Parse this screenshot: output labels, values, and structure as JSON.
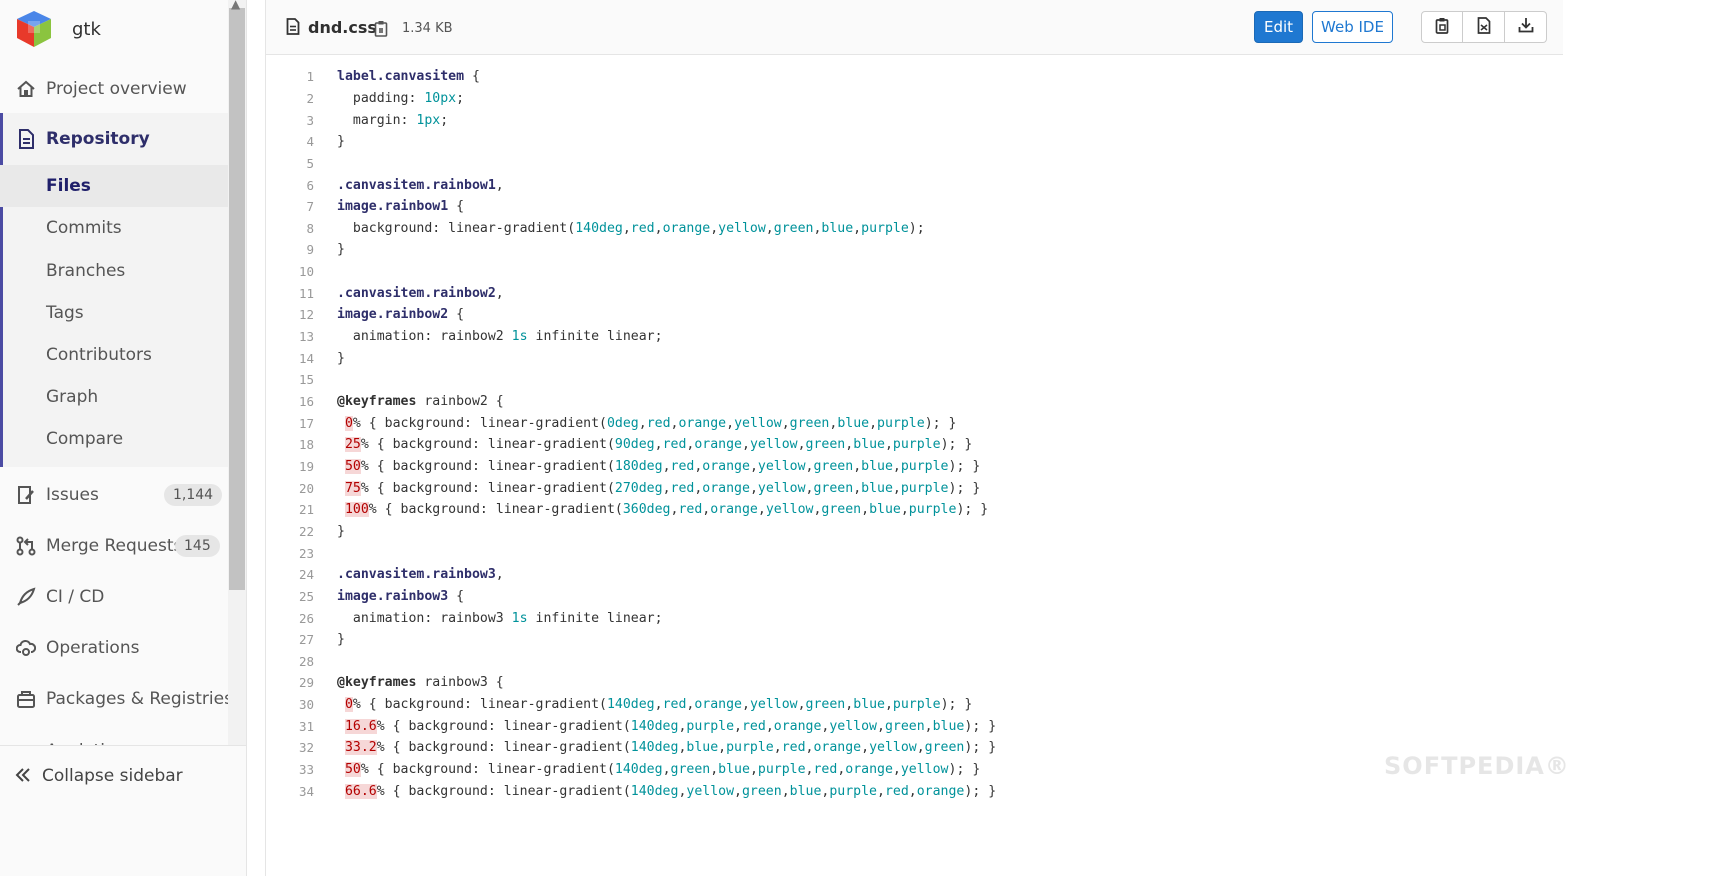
{
  "project": {
    "name": "gtk"
  },
  "nav": {
    "overview": "Project overview",
    "repository": "Repository",
    "repo_items": [
      "Files",
      "Commits",
      "Branches",
      "Tags",
      "Contributors",
      "Graph",
      "Compare"
    ],
    "issues": {
      "label": "Issues",
      "count": "1,144"
    },
    "merge_requests": {
      "label": "Merge Requests",
      "count": "145"
    },
    "cicd": "CI / CD",
    "operations": "Operations",
    "packages": "Packages & Registries",
    "analytics": "Analytics",
    "collapse": "Collapse sidebar"
  },
  "file": {
    "name": "dnd.css",
    "size": "1.34 KB",
    "edit_label": "Edit",
    "webide_label": "Web IDE"
  },
  "code_lines": [
    [
      [
        "sel",
        "label.canvasitem"
      ],
      [
        "t",
        " {"
      ]
    ],
    [
      [
        "t",
        "  padding: "
      ],
      [
        "num",
        "10px"
      ],
      [
        "t",
        ";"
      ]
    ],
    [
      [
        "t",
        "  margin: "
      ],
      [
        "num",
        "1px"
      ],
      [
        "t",
        ";"
      ]
    ],
    [
      [
        "t",
        "}"
      ]
    ],
    [],
    [
      [
        "sel",
        ".canvasitem.rainbow1"
      ],
      [
        "t",
        ","
      ]
    ],
    [
      [
        "sel",
        "image.rainbow1"
      ],
      [
        "t",
        " {"
      ]
    ],
    [
      [
        "t",
        "  background: linear-gradient("
      ],
      [
        "num",
        "140deg"
      ],
      [
        "t",
        ","
      ],
      [
        "num",
        "red"
      ],
      [
        "t",
        ","
      ],
      [
        "num",
        "orange"
      ],
      [
        "t",
        ","
      ],
      [
        "num",
        "yellow"
      ],
      [
        "t",
        ","
      ],
      [
        "num",
        "green"
      ],
      [
        "t",
        ","
      ],
      [
        "num",
        "blue"
      ],
      [
        "t",
        ","
      ],
      [
        "num",
        "purple"
      ],
      [
        "t",
        ");"
      ]
    ],
    [
      [
        "t",
        "}"
      ]
    ],
    [],
    [
      [
        "sel",
        ".canvasitem.rainbow2"
      ],
      [
        "t",
        ","
      ]
    ],
    [
      [
        "sel",
        "image.rainbow2"
      ],
      [
        "t",
        " {"
      ]
    ],
    [
      [
        "t",
        "  animation: rainbow2 "
      ],
      [
        "num",
        "1s"
      ],
      [
        "t",
        " infinite linear;"
      ]
    ],
    [
      [
        "t",
        "}"
      ]
    ],
    [],
    [
      [
        "kw",
        "@keyframes"
      ],
      [
        "t",
        " rainbow2 {"
      ]
    ],
    [
      [
        "t",
        " "
      ],
      [
        "pct",
        "0"
      ],
      [
        "t",
        "% { background: linear-gradient("
      ],
      [
        "num",
        "0deg"
      ],
      [
        "t",
        ","
      ],
      [
        "num",
        "red"
      ],
      [
        "t",
        ","
      ],
      [
        "num",
        "orange"
      ],
      [
        "t",
        ","
      ],
      [
        "num",
        "yellow"
      ],
      [
        "t",
        ","
      ],
      [
        "num",
        "green"
      ],
      [
        "t",
        ","
      ],
      [
        "num",
        "blue"
      ],
      [
        "t",
        ","
      ],
      [
        "num",
        "purple"
      ],
      [
        "t",
        "); }"
      ]
    ],
    [
      [
        "t",
        " "
      ],
      [
        "pct",
        "25"
      ],
      [
        "t",
        "% { background: linear-gradient("
      ],
      [
        "num",
        "90deg"
      ],
      [
        "t",
        ","
      ],
      [
        "num",
        "red"
      ],
      [
        "t",
        ","
      ],
      [
        "num",
        "orange"
      ],
      [
        "t",
        ","
      ],
      [
        "num",
        "yellow"
      ],
      [
        "t",
        ","
      ],
      [
        "num",
        "green"
      ],
      [
        "t",
        ","
      ],
      [
        "num",
        "blue"
      ],
      [
        "t",
        ","
      ],
      [
        "num",
        "purple"
      ],
      [
        "t",
        "); }"
      ]
    ],
    [
      [
        "t",
        " "
      ],
      [
        "pct",
        "50"
      ],
      [
        "t",
        "% { background: linear-gradient("
      ],
      [
        "num",
        "180deg"
      ],
      [
        "t",
        ","
      ],
      [
        "num",
        "red"
      ],
      [
        "t",
        ","
      ],
      [
        "num",
        "orange"
      ],
      [
        "t",
        ","
      ],
      [
        "num",
        "yellow"
      ],
      [
        "t",
        ","
      ],
      [
        "num",
        "green"
      ],
      [
        "t",
        ","
      ],
      [
        "num",
        "blue"
      ],
      [
        "t",
        ","
      ],
      [
        "num",
        "purple"
      ],
      [
        "t",
        "); }"
      ]
    ],
    [
      [
        "t",
        " "
      ],
      [
        "pct",
        "75"
      ],
      [
        "t",
        "% { background: linear-gradient("
      ],
      [
        "num",
        "270deg"
      ],
      [
        "t",
        ","
      ],
      [
        "num",
        "red"
      ],
      [
        "t",
        ","
      ],
      [
        "num",
        "orange"
      ],
      [
        "t",
        ","
      ],
      [
        "num",
        "yellow"
      ],
      [
        "t",
        ","
      ],
      [
        "num",
        "green"
      ],
      [
        "t",
        ","
      ],
      [
        "num",
        "blue"
      ],
      [
        "t",
        ","
      ],
      [
        "num",
        "purple"
      ],
      [
        "t",
        "); }"
      ]
    ],
    [
      [
        "t",
        " "
      ],
      [
        "pct",
        "100"
      ],
      [
        "t",
        "% { background: linear-gradient("
      ],
      [
        "num",
        "360deg"
      ],
      [
        "t",
        ","
      ],
      [
        "num",
        "red"
      ],
      [
        "t",
        ","
      ],
      [
        "num",
        "orange"
      ],
      [
        "t",
        ","
      ],
      [
        "num",
        "yellow"
      ],
      [
        "t",
        ","
      ],
      [
        "num",
        "green"
      ],
      [
        "t",
        ","
      ],
      [
        "num",
        "blue"
      ],
      [
        "t",
        ","
      ],
      [
        "num",
        "purple"
      ],
      [
        "t",
        "); }"
      ]
    ],
    [
      [
        "t",
        "}"
      ]
    ],
    [],
    [
      [
        "sel",
        ".canvasitem.rainbow3"
      ],
      [
        "t",
        ","
      ]
    ],
    [
      [
        "sel",
        "image.rainbow3"
      ],
      [
        "t",
        " {"
      ]
    ],
    [
      [
        "t",
        "  animation: rainbow3 "
      ],
      [
        "num",
        "1s"
      ],
      [
        "t",
        " infinite linear;"
      ]
    ],
    [
      [
        "t",
        "}"
      ]
    ],
    [],
    [
      [
        "kw",
        "@keyframes"
      ],
      [
        "t",
        " rainbow3 {"
      ]
    ],
    [
      [
        "t",
        " "
      ],
      [
        "pct",
        "0"
      ],
      [
        "t",
        "% { background: linear-gradient("
      ],
      [
        "num",
        "140deg"
      ],
      [
        "t",
        ","
      ],
      [
        "num",
        "red"
      ],
      [
        "t",
        ","
      ],
      [
        "num",
        "orange"
      ],
      [
        "t",
        ","
      ],
      [
        "num",
        "yellow"
      ],
      [
        "t",
        ","
      ],
      [
        "num",
        "green"
      ],
      [
        "t",
        ","
      ],
      [
        "num",
        "blue"
      ],
      [
        "t",
        ","
      ],
      [
        "num",
        "purple"
      ],
      [
        "t",
        "); }"
      ]
    ],
    [
      [
        "t",
        " "
      ],
      [
        "pct",
        "16.6"
      ],
      [
        "t",
        "% { background: linear-gradient("
      ],
      [
        "num",
        "140deg"
      ],
      [
        "t",
        ","
      ],
      [
        "num",
        "purple"
      ],
      [
        "t",
        ","
      ],
      [
        "num",
        "red"
      ],
      [
        "t",
        ","
      ],
      [
        "num",
        "orange"
      ],
      [
        "t",
        ","
      ],
      [
        "num",
        "yellow"
      ],
      [
        "t",
        ","
      ],
      [
        "num",
        "green"
      ],
      [
        "t",
        ","
      ],
      [
        "num",
        "blue"
      ],
      [
        "t",
        "); }"
      ]
    ],
    [
      [
        "t",
        " "
      ],
      [
        "pct",
        "33.2"
      ],
      [
        "t",
        "% { background: linear-gradient("
      ],
      [
        "num",
        "140deg"
      ],
      [
        "t",
        ","
      ],
      [
        "num",
        "blue"
      ],
      [
        "t",
        ","
      ],
      [
        "num",
        "purple"
      ],
      [
        "t",
        ","
      ],
      [
        "num",
        "red"
      ],
      [
        "t",
        ","
      ],
      [
        "num",
        "orange"
      ],
      [
        "t",
        ","
      ],
      [
        "num",
        "yellow"
      ],
      [
        "t",
        ","
      ],
      [
        "num",
        "green"
      ],
      [
        "t",
        "); }"
      ]
    ],
    [
      [
        "t",
        " "
      ],
      [
        "pct",
        "50"
      ],
      [
        "t",
        "% { background: linear-gradient("
      ],
      [
        "num",
        "140deg"
      ],
      [
        "t",
        ","
      ],
      [
        "num",
        "green"
      ],
      [
        "t",
        ","
      ],
      [
        "num",
        "blue"
      ],
      [
        "t",
        ","
      ],
      [
        "num",
        "purple"
      ],
      [
        "t",
        ","
      ],
      [
        "num",
        "red"
      ],
      [
        "t",
        ","
      ],
      [
        "num",
        "orange"
      ],
      [
        "t",
        ","
      ],
      [
        "num",
        "yellow"
      ],
      [
        "t",
        "); }"
      ]
    ],
    [
      [
        "t",
        " "
      ],
      [
        "pct",
        "66.6"
      ],
      [
        "t",
        "% { background: linear-gradient("
      ],
      [
        "num",
        "140deg"
      ],
      [
        "t",
        ","
      ],
      [
        "num",
        "yellow"
      ],
      [
        "t",
        ","
      ],
      [
        "num",
        "green"
      ],
      [
        "t",
        ","
      ],
      [
        "num",
        "blue"
      ],
      [
        "t",
        ","
      ],
      [
        "num",
        "purple"
      ],
      [
        "t",
        ","
      ],
      [
        "num",
        "red"
      ],
      [
        "t",
        ","
      ],
      [
        "num",
        "orange"
      ],
      [
        "t",
        "); }"
      ]
    ]
  ],
  "watermark": "SOFTPEDIA®"
}
